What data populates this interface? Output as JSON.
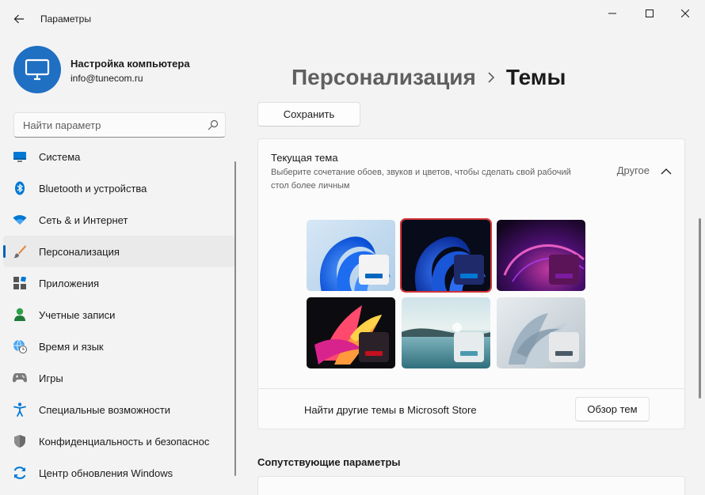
{
  "window": {
    "title": "Параметры"
  },
  "profile": {
    "name": "Настройка компьютера",
    "email": "info@tunecom.ru"
  },
  "search": {
    "placeholder": "Найти параметр"
  },
  "nav": {
    "items": [
      {
        "label": "Система",
        "icon": "monitor-icon"
      },
      {
        "label": "Bluetooth и устройства",
        "icon": "bluetooth-icon"
      },
      {
        "label": "Сеть & и Интернет",
        "icon": "wifi-icon"
      },
      {
        "label": "Персонализация",
        "icon": "brush-icon",
        "active": true
      },
      {
        "label": "Приложения",
        "icon": "apps-icon"
      },
      {
        "label": "Учетные записи",
        "icon": "person-icon"
      },
      {
        "label": "Время и язык",
        "icon": "globe-clock-icon"
      },
      {
        "label": "Игры",
        "icon": "gamepad-icon"
      },
      {
        "label": "Специальные возможности",
        "icon": "accessibility-icon"
      },
      {
        "label": "Конфиденциальность и безопаснос",
        "icon": "shield-icon"
      },
      {
        "label": "Центр обновления Windows",
        "icon": "update-icon"
      }
    ]
  },
  "breadcrumb": {
    "parent": "Персонализация",
    "current": "Темы"
  },
  "toolbar": {
    "save_label": "Сохранить"
  },
  "current_theme": {
    "title": "Текущая тема",
    "description": "Выберите сочетание обоев, звуков и цветов, чтобы сделать свой рабочий стол более личным",
    "value": "Другое",
    "expanded": true
  },
  "themes": [
    {
      "name": "windows-light",
      "accent": "#0067c0",
      "swatch_bg": "#f3f3f3",
      "selected": false
    },
    {
      "name": "windows-dark",
      "accent": "#0078d4",
      "swatch_bg": "#1f2a6b",
      "selected": true
    },
    {
      "name": "glow",
      "accent": "#7a1ca0",
      "swatch_bg": "#5b1458",
      "selected": false
    },
    {
      "name": "captured-motion",
      "accent": "#c50f1f",
      "swatch_bg": "#2a2228",
      "selected": false
    },
    {
      "name": "sunrise",
      "accent": "#4a9ab0",
      "swatch_bg": "#e6ecee",
      "selected": false
    },
    {
      "name": "flow",
      "accent": "#4a5a66",
      "swatch_bg": "#e6e8ea",
      "selected": false
    }
  ],
  "store": {
    "text": "Найти другие темы в Microsoft Store",
    "button_label": "Обзор тем"
  },
  "related": {
    "title": "Сопутствующие параметры"
  },
  "colors": {
    "accent": "#005fb8",
    "selected_outline": "#d13438"
  }
}
